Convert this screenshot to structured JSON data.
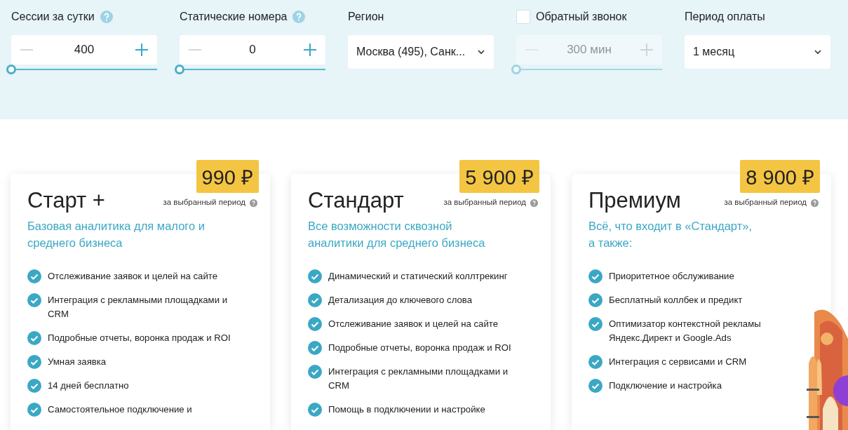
{
  "controls": [
    {
      "kind": "stepper",
      "label": "Сессии за сутки",
      "help": true,
      "value": "400",
      "disabled": false,
      "level": 0
    },
    {
      "kind": "stepper",
      "label": "Статические номера",
      "help": true,
      "value": "0",
      "disabled": false,
      "level": 0
    },
    {
      "kind": "select",
      "label": "Регион",
      "value": "Москва (495), Санк..."
    },
    {
      "kind": "stepper",
      "label": "Обратный звонок",
      "checked": false,
      "value": "300 мин",
      "disabled": true,
      "level": 0
    },
    {
      "kind": "select",
      "label": "Период оплаты",
      "value": "1 месяц"
    }
  ],
  "plans": [
    {
      "name": "Старт +",
      "price": "990 ₽",
      "period": "за выбранный период",
      "subtitle": "Базовая аналитика для малого и среднего бизнеса",
      "features": [
        "Отслеживание заявок и целей на сайте",
        "Интеграция с рекламными площадками и CRM",
        "Подробные отчеты, воронка продаж и ROI",
        "Умная заявка",
        "14 дней бесплатно",
        "Самостоятельное подключение и"
      ]
    },
    {
      "name": "Стандарт",
      "price": "5 900 ₽",
      "period": "за выбранный период",
      "subtitle": "Все возможности сквозной аналитики для среднего бизнеса",
      "features": [
        "Динамический и статический коллтрекинг",
        "Детализация до ключевого слова",
        "Отслеживание заявок и целей на сайте",
        "Подробные отчеты, воронка продаж и ROI",
        "Интеграция с рекламными площадками и CRM",
        "Помощь в подключении и настройке"
      ]
    },
    {
      "name": "Премиум",
      "price": "8 900 ₽",
      "period": "за выбранный период",
      "subtitle": "Всё, что входит в «Стандарт»,\nа также:",
      "features": [
        "Приоритетное обслуживание",
        "Бесплатный коллбек и предикт",
        "Оптимизатор контекстной рекламы Яндекс.Директ и Google.Ads",
        "Интеграция с сервисами и CRM",
        "Подключение и настройка"
      ]
    }
  ]
}
